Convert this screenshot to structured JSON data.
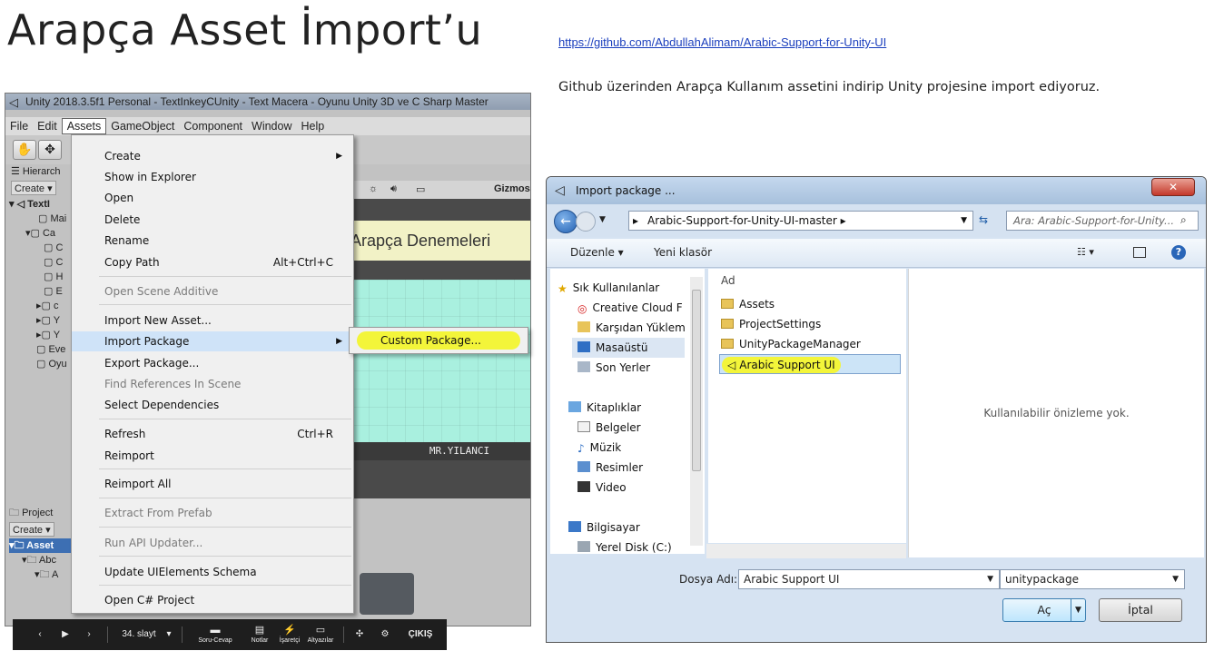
{
  "slide": {
    "title": "Arapça Asset  İmport’u",
    "link": "https://github.com/AbdullahAlimam/Arabic-Support-for-Unity-UI",
    "description": "Github üzerinden Arapça Kullanım assetini indirip Unity projesine import ediyoruz."
  },
  "unity": {
    "window_title": "Unity 2018.3.5f1 Personal - TextInkeyCUnity - Text Macera - Oyunu Unity 3D ve C Sharp Master",
    "menubar": [
      "File",
      "Edit",
      "Assets",
      "GameObject",
      "Component",
      "Window",
      "Help"
    ],
    "hierarchy": {
      "tab": "Hierarch",
      "create": "Create",
      "rows": [
        "TextI",
        "Mai",
        "Ca",
        "C",
        "C",
        "H",
        "E",
        "c",
        "Y",
        "Y",
        "Eve",
        "Oyu"
      ]
    },
    "scene": {
      "gizmos": "Gizmos",
      "banner": "Arapça Denemeleri",
      "name_label": "MR.YILANCI"
    },
    "project": {
      "tab": "Project",
      "create": "Create",
      "rows": [
        "Asset",
        "Abc",
        "A"
      ]
    },
    "assets_menu": {
      "items": [
        {
          "label": "Create",
          "submenu": true
        },
        {
          "label": "Show in Explorer"
        },
        {
          "label": "Open"
        },
        {
          "label": "Delete"
        },
        {
          "label": "Rename"
        },
        {
          "label": "Copy Path",
          "shortcut": "Alt+Ctrl+C"
        },
        {
          "label": "Open Scene Additive",
          "disabled": true
        },
        {
          "label": "Import New Asset..."
        },
        {
          "label": "Import Package",
          "submenu": true,
          "highlighted": true
        },
        {
          "label": "Export Package..."
        },
        {
          "label": "Find References In Scene",
          "disabled": true
        },
        {
          "label": "Select Dependencies"
        },
        {
          "label": "Refresh",
          "shortcut": "Ctrl+R"
        },
        {
          "label": "Reimport"
        },
        {
          "label": "Reimport All"
        },
        {
          "label": "Extract From Prefab",
          "disabled": true
        },
        {
          "label": "Run API Updater...",
          "disabled": true
        },
        {
          "label": "Update UIElements Schema"
        },
        {
          "label": "Open C# Project"
        }
      ],
      "submenu_item": "Custom Package..."
    }
  },
  "slidebar": {
    "slide_label": "34. slayt",
    "qa": "Soru-Cevap",
    "notes": "Notlar",
    "pointer": "İşaretçi",
    "subtitles": "Altyazılar",
    "exit": "ÇIKIŞ"
  },
  "dialog": {
    "title": "Import package ...",
    "path": "Arabic-Support-for-Unity-UI-master",
    "search_placeholder": "Ara: Arabic-Support-for-Unity...",
    "organize": "Düzenle",
    "new_folder": "Yeni klasör",
    "nav": {
      "favorites": "Sık Kullanılanlar",
      "items": [
        "Creative Cloud F",
        "Karşıdan Yüklem",
        "Masaüstü",
        "Son Yerler"
      ],
      "libraries": "Kitaplıklar",
      "library_items": [
        "Belgeler",
        "Müzik",
        "Resimler",
        "Video"
      ],
      "computer": "Bilgisayar",
      "computer_items": [
        "Yerel Disk (C:)"
      ]
    },
    "column_name": "Ad",
    "files": [
      "Assets",
      "ProjectSettings",
      "UnityPackageManager",
      "Arabic Support UI"
    ],
    "preview_text": "Kullanılabilir önizleme yok.",
    "filename_label": "Dosya Adı:",
    "filename_value": "Arabic Support UI",
    "filter_value": "unitypackage",
    "open_button": "Aç",
    "cancel_button": "İptal"
  },
  "colors": {
    "highlight_yellow": "#f3f53a",
    "link_blue": "#1a3ebd",
    "dialog_frame": "#d6e3f2"
  }
}
